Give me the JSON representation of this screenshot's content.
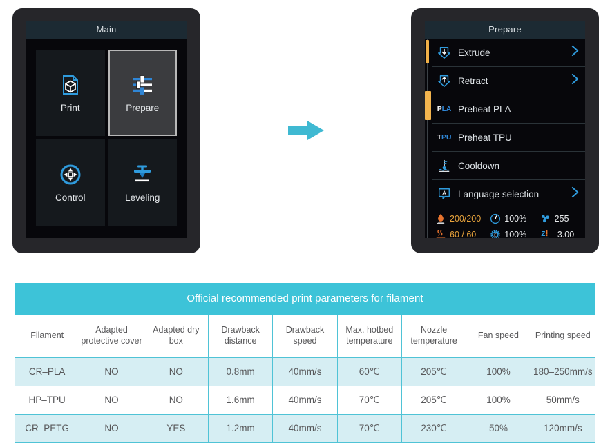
{
  "main_screen": {
    "title": "Main",
    "tiles": [
      {
        "label": "Print",
        "icon": "print-page-cube-icon",
        "selected": false
      },
      {
        "label": "Prepare",
        "icon": "sliders-icon",
        "selected": true
      },
      {
        "label": "Control",
        "icon": "dpad-circle-icon",
        "selected": false
      },
      {
        "label": "Leveling",
        "icon": "nozzle-plate-icon",
        "selected": false
      }
    ]
  },
  "flow": {
    "arrow_icon": "arrow-right-icon",
    "arrow_color": "#3fb9d2"
  },
  "prepare_screen": {
    "title": "Prepare",
    "items": [
      {
        "label": "Extrude",
        "icon": "extrude-arrow-down-icon",
        "chevron": "›",
        "badge": null,
        "highlight": "thin"
      },
      {
        "label": "Retract",
        "icon": "retract-arrow-up-icon",
        "chevron": "›",
        "badge": null,
        "highlight": null
      },
      {
        "label": "Preheat PLA",
        "icon": "pla-badge-icon",
        "chevron": "",
        "badge": {
          "w": "P",
          "b": "LA"
        },
        "highlight": "thick"
      },
      {
        "label": "Preheat TPU",
        "icon": "tpu-badge-icon",
        "chevron": "",
        "badge": {
          "w": "T",
          "b": "PU"
        },
        "highlight": null
      },
      {
        "label": "Cooldown",
        "icon": "thermometer-waves-icon",
        "chevron": "",
        "badge": null,
        "highlight": null
      },
      {
        "label": "Language selection",
        "icon": "speech-bubble-a-icon",
        "chevron": "›",
        "badge": null,
        "highlight": null
      }
    ],
    "status": {
      "row1": [
        {
          "icon": "nozzle-temp-icon",
          "value": "200/200",
          "amber": true
        },
        {
          "icon": "speed-gauge-icon",
          "value": "100%",
          "amber": false
        },
        {
          "icon": "fan-icon",
          "value": "255",
          "amber": false
        }
      ],
      "row2": [
        {
          "icon": "hotbed-temp-icon",
          "value": "60 / 60",
          "amber": true
        },
        {
          "icon": "extrusion-gear-icon",
          "value": "100%",
          "amber": false
        },
        {
          "icon": "z-offset-icon",
          "value": "-3.00",
          "amber": false
        }
      ]
    }
  },
  "table": {
    "banner": "Official recommended print parameters for filament",
    "columns": [
      "Filament",
      "Adapted protective cover",
      "Adapted dry box",
      "Drawback distance",
      "Drawback speed",
      "Max. hotbed temperature",
      "Nozzle temperature",
      "Fan speed",
      "Printing speed"
    ],
    "rows": [
      [
        "CR–PLA",
        "NO",
        "NO",
        "0.8mm",
        "40mm/s",
        "60℃",
        "205℃",
        "100%",
        "180–250mm/s"
      ],
      [
        "HP–TPU",
        "NO",
        "NO",
        "1.6mm",
        "40mm/s",
        "70℃",
        "205℃",
        "100%",
        "50mm/s"
      ],
      [
        "CR–PETG",
        "NO",
        "YES",
        "1.2mm",
        "40mm/s",
        "70℃",
        "230℃",
        "50%",
        "120mm/s"
      ]
    ],
    "accent_color": "#3dc3d8",
    "row_tint": "#d6eef3"
  }
}
